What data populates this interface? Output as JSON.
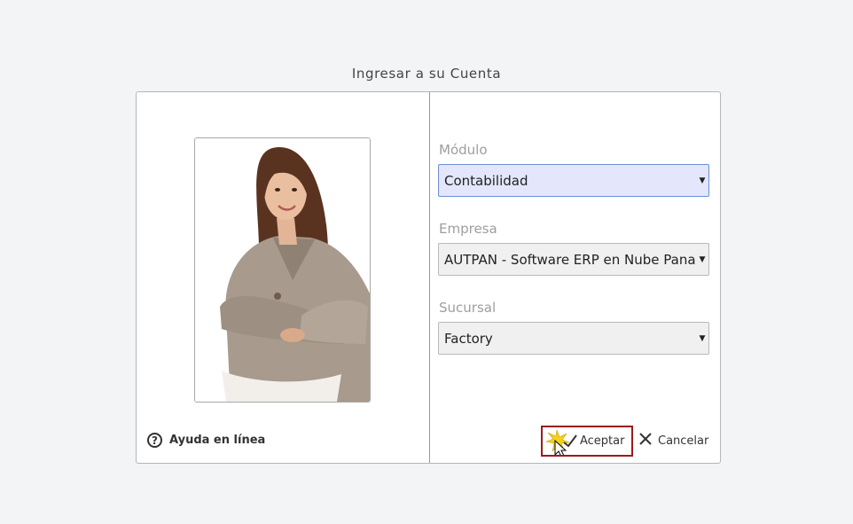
{
  "dialog": {
    "title": "Ingresar a su Cuenta",
    "help_label": "Ayuda en línea"
  },
  "form": {
    "modulo": {
      "label": "Módulo",
      "value": "Contabilidad"
    },
    "empresa": {
      "label": "Empresa",
      "value": "AUTPAN - Software ERP en Nube Panamá"
    },
    "sucursal": {
      "label": "Sucursal",
      "value": "Factory"
    }
  },
  "buttons": {
    "accept_label": "Aceptar",
    "cancel_label": "Cancelar"
  },
  "icons": {
    "help": "question-circle-icon",
    "accept": "checkmark-icon",
    "cancel": "close-icon",
    "dropdown": "triangle-down-icon"
  },
  "colors": {
    "accent_border": "#9b1b1b",
    "active_select_bg": "#e4e6fc",
    "active_select_border": "#6b8ed6"
  }
}
